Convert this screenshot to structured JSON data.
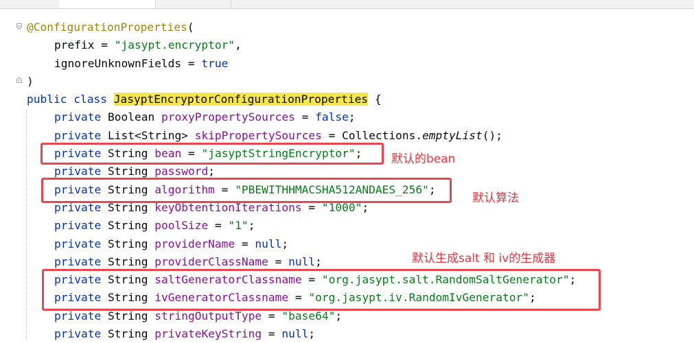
{
  "editor": {
    "code": {
      "annotation": "@ConfigurationProperties",
      "open_paren": "(",
      "prefix_key": "prefix",
      "eq": " = ",
      "prefix_value": "\"jasypt.encryptor\"",
      "comma": ",",
      "ignore_key": "ignoreUnknownFields",
      "true": "true",
      "close_paren": ")",
      "public": "public",
      "class": "class",
      "class_name": "JasyptEncryptorConfigurationProperties",
      "brace": "{",
      "private": "private",
      "semi": ";",
      "fields": [
        {
          "type": "Boolean",
          "name": "proxyPropertySources",
          "value": "false"
        },
        {
          "type": "List<String>",
          "name": "skipPropertySources",
          "value_class": "Collections",
          "value_method": "emptyList",
          "value_call": "()"
        },
        {
          "type": "String",
          "name": "bean",
          "value": "\"jasyptStringEncryptor\""
        },
        {
          "type": "String",
          "name": "password"
        },
        {
          "type": "String",
          "name": "algorithm",
          "value": "\"PBEWITHHMACSHA512ANDAES_256\""
        },
        {
          "type": "String",
          "name": "keyObtentionIterations",
          "value": "\"1000\""
        },
        {
          "type": "String",
          "name": "poolSize",
          "value": "\"1\""
        },
        {
          "type": "String",
          "name": "providerName",
          "value": "null"
        },
        {
          "type": "String",
          "name": "providerClassName",
          "value": "null"
        },
        {
          "type": "String",
          "name": "saltGeneratorClassname",
          "value": "\"org.jasypt.salt.RandomSaltGenerator\""
        },
        {
          "type": "String",
          "name": "ivGeneratorClassname",
          "value": "\"org.jasypt.iv.RandomIvGenerator\""
        },
        {
          "type": "String",
          "name": "stringOutputType",
          "value": "\"base64\""
        },
        {
          "type": "String",
          "name": "privateKeyString",
          "value": "null"
        }
      ]
    }
  },
  "annotations": {
    "bean_note": "默认的bean",
    "algorithm_note": "默认算法",
    "generator_note": "默认生成salt 和 iv的生成器"
  },
  "colors": {
    "highlight_box": "#e8464f",
    "note_text": "#e8333c",
    "class_highlight": "#f5e64e"
  }
}
